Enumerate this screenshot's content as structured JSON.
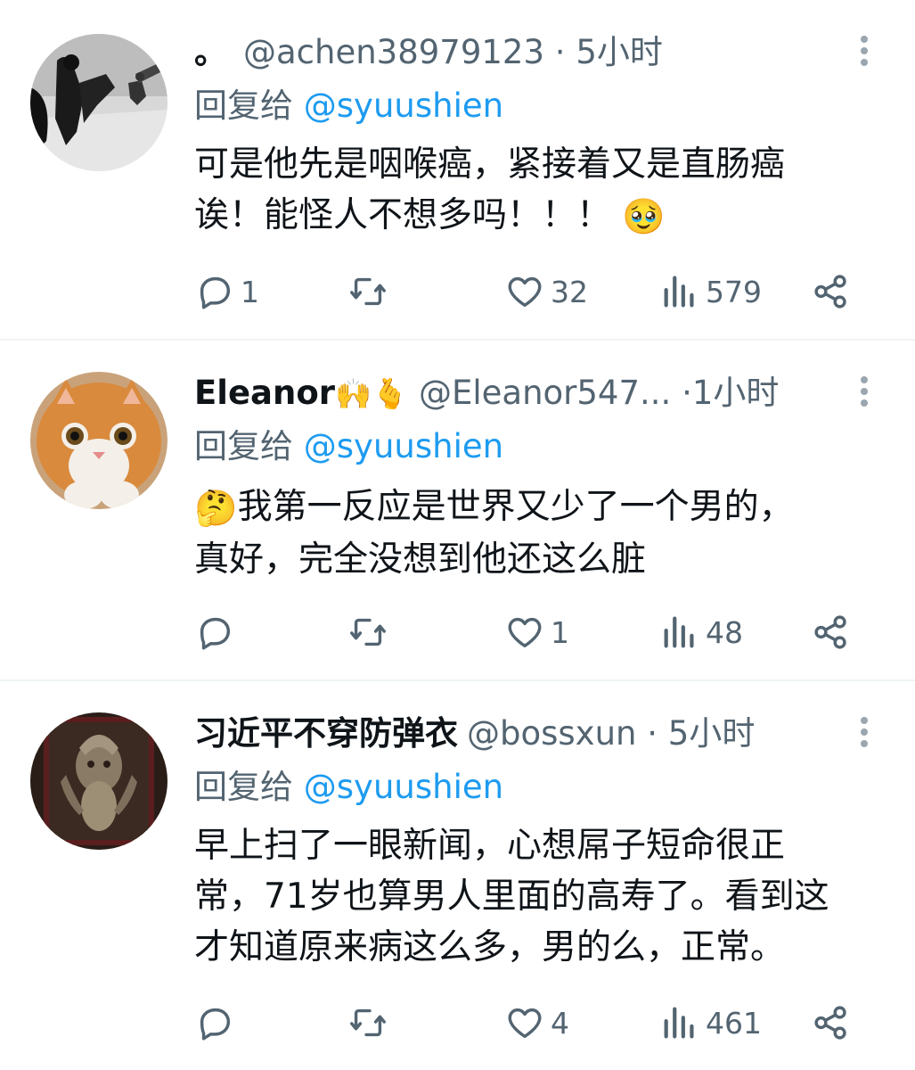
{
  "tweets": [
    {
      "name": "。",
      "handle": "@achen38979123",
      "dot": "·",
      "time": "5小时",
      "reply_prefix": "回复给",
      "reply_to": "@syuushien",
      "text": "可是他先是咽喉癌，紧接着又是直肠癌\n诶！能怪人不想多吗！！！",
      "text_emoji": "🥹",
      "replies": "1",
      "retweets": "",
      "likes": "32",
      "views": "579",
      "icons": [
        "reply-icon",
        "retweet-icon",
        "like-icon",
        "views-icon",
        "share-icon"
      ]
    },
    {
      "name": "Eleanor",
      "name_emojis": "🙌🫰",
      "handle": "@Eleanor547...",
      "dot": "·",
      "time": "1小时",
      "reply_prefix": "回复给",
      "reply_to": "@syuushien",
      "text_emoji": "🤔",
      "text": "我第一反应是世界又少了一个男的，\n真好，完全没想到他还这么脏",
      "replies": "",
      "retweets": "",
      "likes": "1",
      "views": "48"
    },
    {
      "name": "习近平不穿防弹衣",
      "handle": "@bossxun",
      "dot": "·",
      "time": "5小时",
      "reply_prefix": "回复给",
      "reply_to": "@syuushien",
      "text": "早上扫了一眼新闻，心想屌子短命很正\n常，71岁也算男人里面的高寿了。看到这\n才知道原来病这么多，男的么，正常。",
      "replies": "",
      "retweets": "",
      "likes": "4",
      "views": "461"
    }
  ],
  "colors": {
    "text": "#0f1419",
    "secondary": "#536471",
    "link": "#1d9bf0",
    "divider": "#eff3f4"
  }
}
